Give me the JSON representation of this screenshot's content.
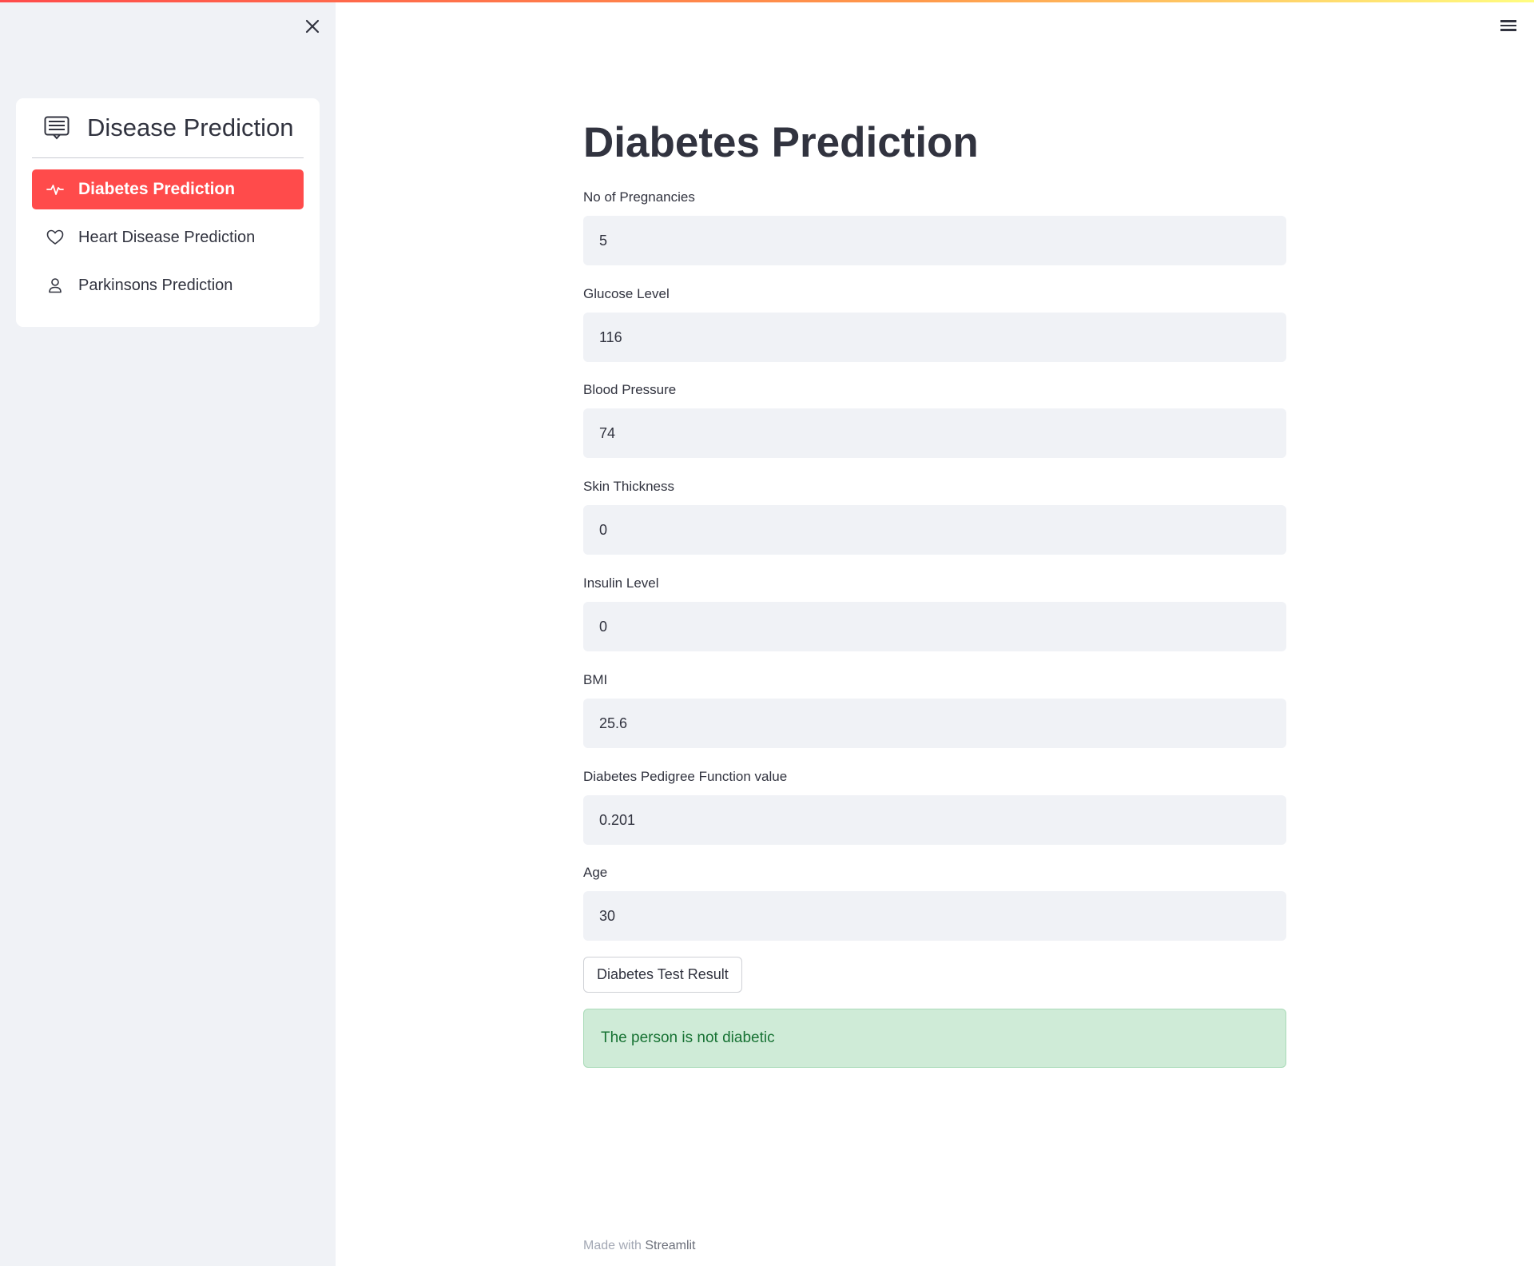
{
  "colors": {
    "accent": "#ff4b4b",
    "sidebar_bg": "#f0f2f6",
    "success_bg": "#cfebd7",
    "success_text": "#177233"
  },
  "sidebar": {
    "close_icon": "close-icon",
    "menu_icon": "document-icon",
    "menu_title": "Disease Prediction",
    "items": [
      {
        "label": "Diabetes Prediction",
        "icon": "activity-icon",
        "active": true
      },
      {
        "label": "Heart Disease Prediction",
        "icon": "heart-icon",
        "active": false
      },
      {
        "label": "Parkinsons Prediction",
        "icon": "person-icon",
        "active": false
      }
    ]
  },
  "header": {
    "menu_icon": "hamburger-icon"
  },
  "main": {
    "title": "Diabetes Prediction",
    "fields": [
      {
        "label": "No of Pregnancies",
        "value": "5"
      },
      {
        "label": "Glucose Level",
        "value": "116"
      },
      {
        "label": "Blood Pressure",
        "value": "74"
      },
      {
        "label": "Skin Thickness",
        "value": "0"
      },
      {
        "label": "Insulin Level",
        "value": "0"
      },
      {
        "label": "BMI",
        "value": "25.6"
      },
      {
        "label": "Diabetes Pedigree Function value",
        "value": "0.201"
      },
      {
        "label": "Age",
        "value": "30"
      }
    ],
    "button_label": "Diabetes Test Result",
    "result_text": "The person is not diabetic"
  },
  "footer": {
    "prefix": "Made with",
    "brand": "Streamlit"
  }
}
